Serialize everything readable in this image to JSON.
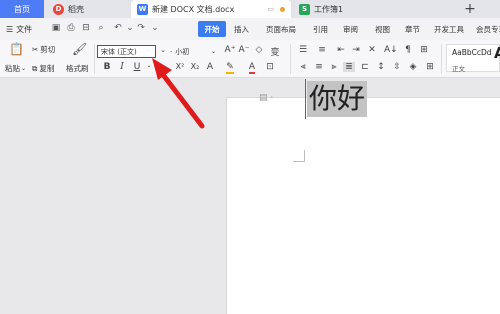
{
  "tabs": {
    "home": "首页",
    "draft": "稻壳",
    "document": "新建 DOCX 文档.docx",
    "spreadsheet": "工作簿1",
    "add": "+"
  },
  "menubar": {
    "file": "文件",
    "items": [
      "开始",
      "插入",
      "页面布局",
      "引用",
      "审阅",
      "视图",
      "章节",
      "开发工具",
      "会员专享"
    ]
  },
  "ribbon": {
    "paste": "粘贴",
    "cut": "剪切",
    "copy": "复制",
    "format_painter": "格式刷",
    "font_name": "宋体 (正文)",
    "font_size": "小初",
    "bold": "B",
    "italic": "I",
    "underline": "U",
    "superscript": "X²",
    "subscript": "X₂",
    "style_sample": "AaBbCcDd",
    "style_name": "正文",
    "big_style": "A"
  },
  "document": {
    "text": "你好"
  },
  "colors": {
    "accent": "#3b7cf1",
    "home_tab": "#4e7cf6",
    "highlight_box": "#c8261c",
    "arrow": "#e01b1b",
    "selection": "#c3c3c3"
  }
}
